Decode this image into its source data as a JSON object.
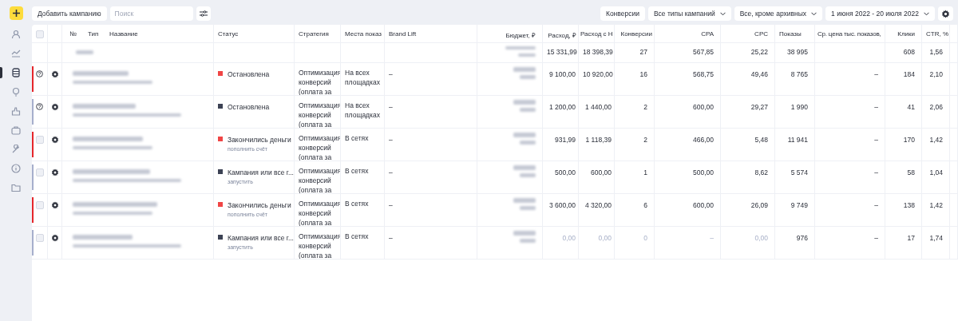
{
  "sidebar": {
    "items": [
      {
        "kind": "add"
      },
      {
        "kind": "user",
        "selected": false
      },
      {
        "kind": "chart",
        "selected": false
      },
      {
        "kind": "database",
        "selected": true
      },
      {
        "kind": "bulb",
        "selected": false
      },
      {
        "kind": "thumb",
        "selected": false
      },
      {
        "kind": "briefcase",
        "selected": false
      },
      {
        "kind": "wrench",
        "selected": false
      },
      {
        "kind": "info",
        "selected": false
      },
      {
        "kind": "folder",
        "selected": false
      }
    ]
  },
  "toolbar": {
    "add_button": "Добавить кампанию",
    "search": {
      "placeholder": "Поиск"
    },
    "right": [
      {
        "kind": "button",
        "label": "Конверсии"
      },
      {
        "kind": "dropdown",
        "label": "Все типы кампаний"
      },
      {
        "kind": "dropdown",
        "label": "Все, кроме архивных"
      },
      {
        "kind": "dropdown",
        "label": "1 июня 2022 - 20 июля 2022"
      },
      {
        "kind": "settings"
      }
    ]
  },
  "table": {
    "header_checkbox": {
      "checked": false
    },
    "columns": [
      "№",
      "Тип",
      "Название",
      "Статус",
      "Стратегия",
      "Места показ",
      "Brand Lift",
      "Бюджет, ₽",
      "Расход, ₽",
      "Расход с Н",
      "Конверсии",
      "CPA",
      "CPC",
      "Показы",
      "Ср. цена тыс. показов,",
      "Клики",
      "CTR, %"
    ],
    "totals": {
      "spend": "15 331,99",
      "spend_vat": "18 398,39",
      "conversions": "27",
      "cpa": "567,85",
      "cpc": "25,22",
      "impressions": "38 995",
      "clicks": "608",
      "ctr": "1,56"
    },
    "rows": [
      {
        "kind": "help",
        "color": "#e5262b",
        "status": {
          "text": "Остановлена",
          "color": "#f04545"
        },
        "strategy": "Оптимизация конверсий (оплата за",
        "places": "На всех площадках",
        "brand_lift": "–",
        "metrics": [
          {
            "text": "9 100,00",
            "muted": false
          },
          {
            "text": "10 920,00",
            "muted": false
          },
          {
            "text": "16",
            "muted": false
          },
          {
            "text": "568,75",
            "muted": false
          },
          {
            "text": "49,46",
            "muted": false
          },
          {
            "text": "8 765",
            "muted": false
          },
          {
            "text": "–",
            "muted": false
          },
          {
            "text": "184",
            "muted": false
          },
          {
            "text": "2,10",
            "muted": false
          }
        ]
      },
      {
        "kind": "help",
        "color": "#a6afcc",
        "status": {
          "text": "Остановлена",
          "color": "#3c4254"
        },
        "strategy": "Оптимизация конверсий (оплата за",
        "places": "На всех площадках",
        "brand_lift": "–",
        "metrics": [
          {
            "text": "1 200,00",
            "muted": false
          },
          {
            "text": "1 440,00",
            "muted": false
          },
          {
            "text": "2",
            "muted": false
          },
          {
            "text": "600,00",
            "muted": false
          },
          {
            "text": "29,27",
            "muted": false
          },
          {
            "text": "1 990",
            "muted": false
          },
          {
            "text": "–",
            "muted": false
          },
          {
            "text": "41",
            "muted": false
          },
          {
            "text": "2,06",
            "muted": false
          }
        ]
      },
      {
        "kind": "checkbox",
        "checked": false,
        "color": "#e5262b",
        "status": {
          "text": "Закончились деньги",
          "color": "#f04545",
          "action": "пополнить счёт"
        },
        "strategy": "Оптимизация конверсий (оплата за",
        "places": "В сетях",
        "brand_lift": "–",
        "metrics": [
          {
            "text": "931,99",
            "muted": false
          },
          {
            "text": "1 118,39",
            "muted": false
          },
          {
            "text": "2",
            "muted": false
          },
          {
            "text": "466,00",
            "muted": false
          },
          {
            "text": "5,48",
            "muted": false
          },
          {
            "text": "11 941",
            "muted": false
          },
          {
            "text": "–",
            "muted": false
          },
          {
            "text": "170",
            "muted": false
          },
          {
            "text": "1,42",
            "muted": false
          }
        ]
      },
      {
        "kind": "checkbox",
        "checked": false,
        "color": "#a6afcc",
        "status": {
          "text": "Кампания или все г...",
          "color": "#3c4254",
          "action": "запустить"
        },
        "strategy": "Оптимизация конверсий (оплата за",
        "places": "В сетях",
        "brand_lift": "–",
        "metrics": [
          {
            "text": "500,00",
            "muted": false
          },
          {
            "text": "600,00",
            "muted": false
          },
          {
            "text": "1",
            "muted": false
          },
          {
            "text": "500,00",
            "muted": false
          },
          {
            "text": "8,62",
            "muted": false
          },
          {
            "text": "5 574",
            "muted": false
          },
          {
            "text": "–",
            "muted": false
          },
          {
            "text": "58",
            "muted": false
          },
          {
            "text": "1,04",
            "muted": false
          }
        ]
      },
      {
        "kind": "checkbox",
        "checked": false,
        "color": "#e5262b",
        "status": {
          "text": "Закончились деньги",
          "color": "#f04545",
          "action": "пополнить счёт"
        },
        "strategy": "Оптимизация конверсий (оплата за",
        "places": "В сетях",
        "brand_lift": "–",
        "metrics": [
          {
            "text": "3 600,00",
            "muted": false
          },
          {
            "text": "4 320,00",
            "muted": false
          },
          {
            "text": "6",
            "muted": false
          },
          {
            "text": "600,00",
            "muted": false
          },
          {
            "text": "26,09",
            "muted": false
          },
          {
            "text": "9 749",
            "muted": false
          },
          {
            "text": "–",
            "muted": false
          },
          {
            "text": "138",
            "muted": false
          },
          {
            "text": "1,42",
            "muted": false
          }
        ]
      },
      {
        "kind": "checkbox",
        "checked": false,
        "color": "#a6afcc",
        "status": {
          "text": "Кампания или все г...",
          "color": "#3c4254",
          "action": "запустить"
        },
        "strategy": "Оптимизация конверсий (оплата за",
        "places": "В сетях",
        "brand_lift": "–",
        "metrics": [
          {
            "text": "0,00",
            "muted": true
          },
          {
            "text": "0,00",
            "muted": true
          },
          {
            "text": "0",
            "muted": true
          },
          {
            "text": "–",
            "muted": true
          },
          {
            "text": "0,00",
            "muted": true
          },
          {
            "text": "976",
            "muted": false
          },
          {
            "text": "–",
            "muted": false
          },
          {
            "text": "17",
            "muted": false
          },
          {
            "text": "1,74",
            "muted": false
          }
        ]
      }
    ]
  }
}
